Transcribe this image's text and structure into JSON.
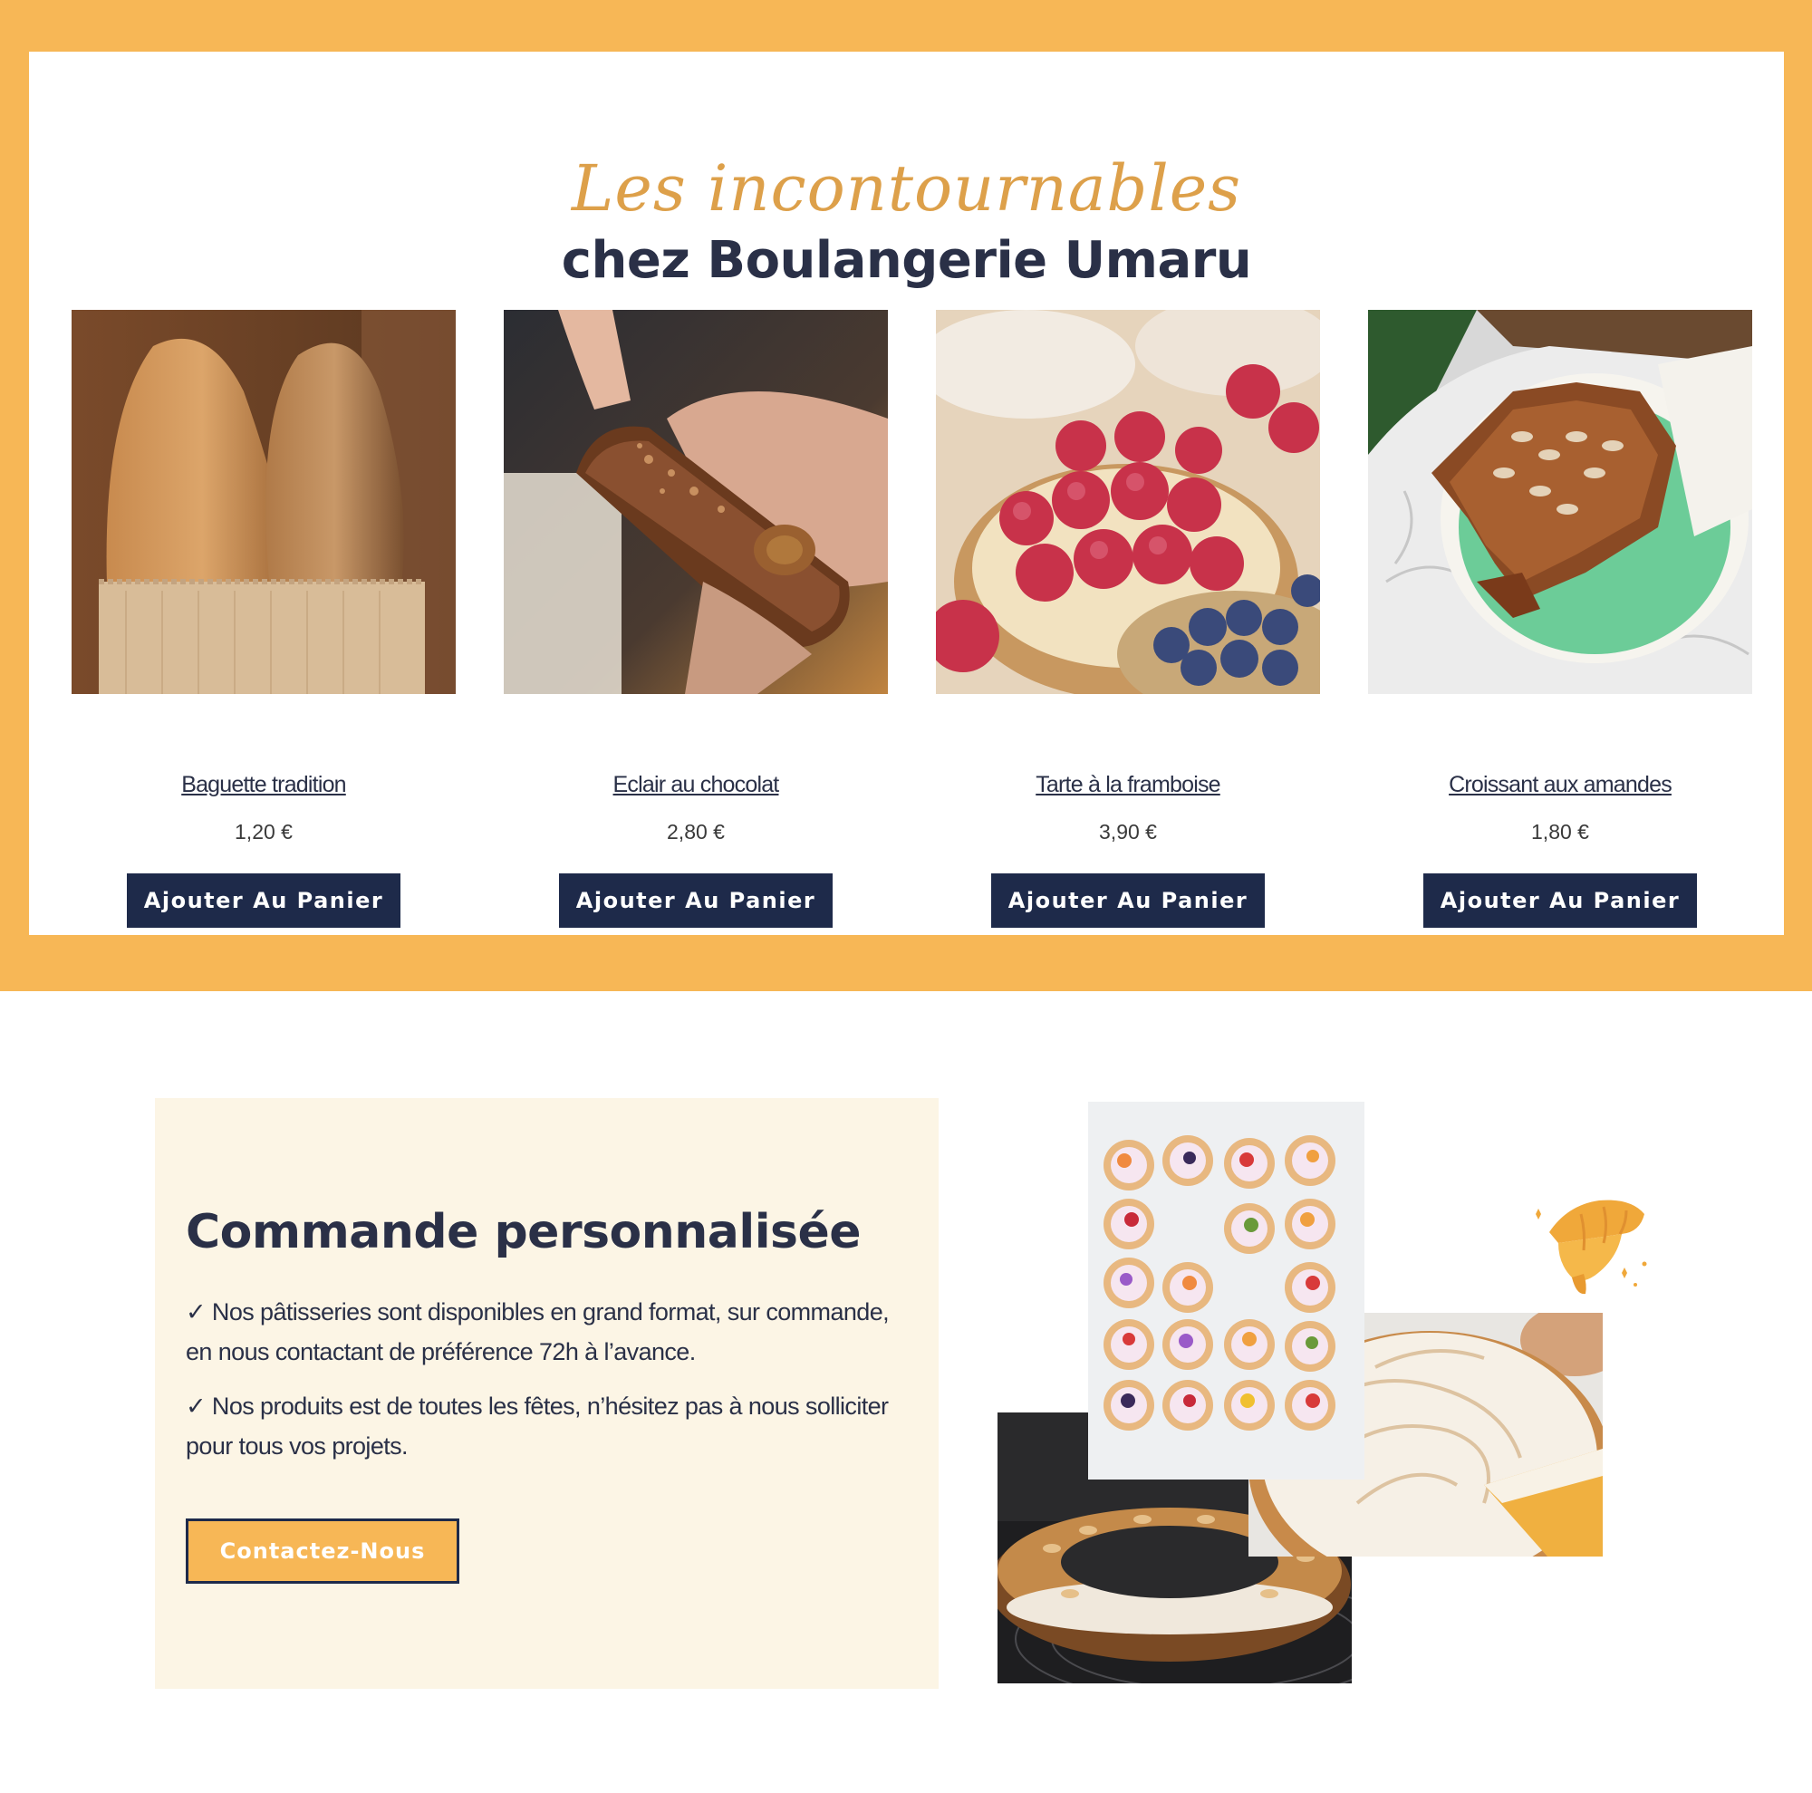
{
  "featured": {
    "script_title": "Les incontournables",
    "title": "chez Boulangerie Umaru",
    "products": [
      {
        "name": "Baguette tradition",
        "price": "1,20 €",
        "button": "Ajouter Au Panier"
      },
      {
        "name": "Eclair au chocolat",
        "price": "2,80 €",
        "button": "Ajouter Au Panier"
      },
      {
        "name": "Tarte à la framboise",
        "price": "3,90 €",
        "button": "Ajouter Au Panier"
      },
      {
        "name": "Croissant aux amandes",
        "price": "1,80 €",
        "button": "Ajouter Au Panier"
      }
    ]
  },
  "custom_order": {
    "title": "Commande personnalisée",
    "line1": "✓ Nos pâtisseries sont disponibles en grand format, sur commande, en nous contactant de préférence 72h à l’avance.",
    "line2": "✓ Nos produits est de toutes les fêtes, n’hésitez pas à nous solliciter pour tous vos projets.",
    "button": "Contactez-Nous"
  },
  "colors": {
    "accent_orange": "#f7b756",
    "navy": "#1e2a4a",
    "script_gold": "#dda04a",
    "cream": "#fcf5e5"
  }
}
